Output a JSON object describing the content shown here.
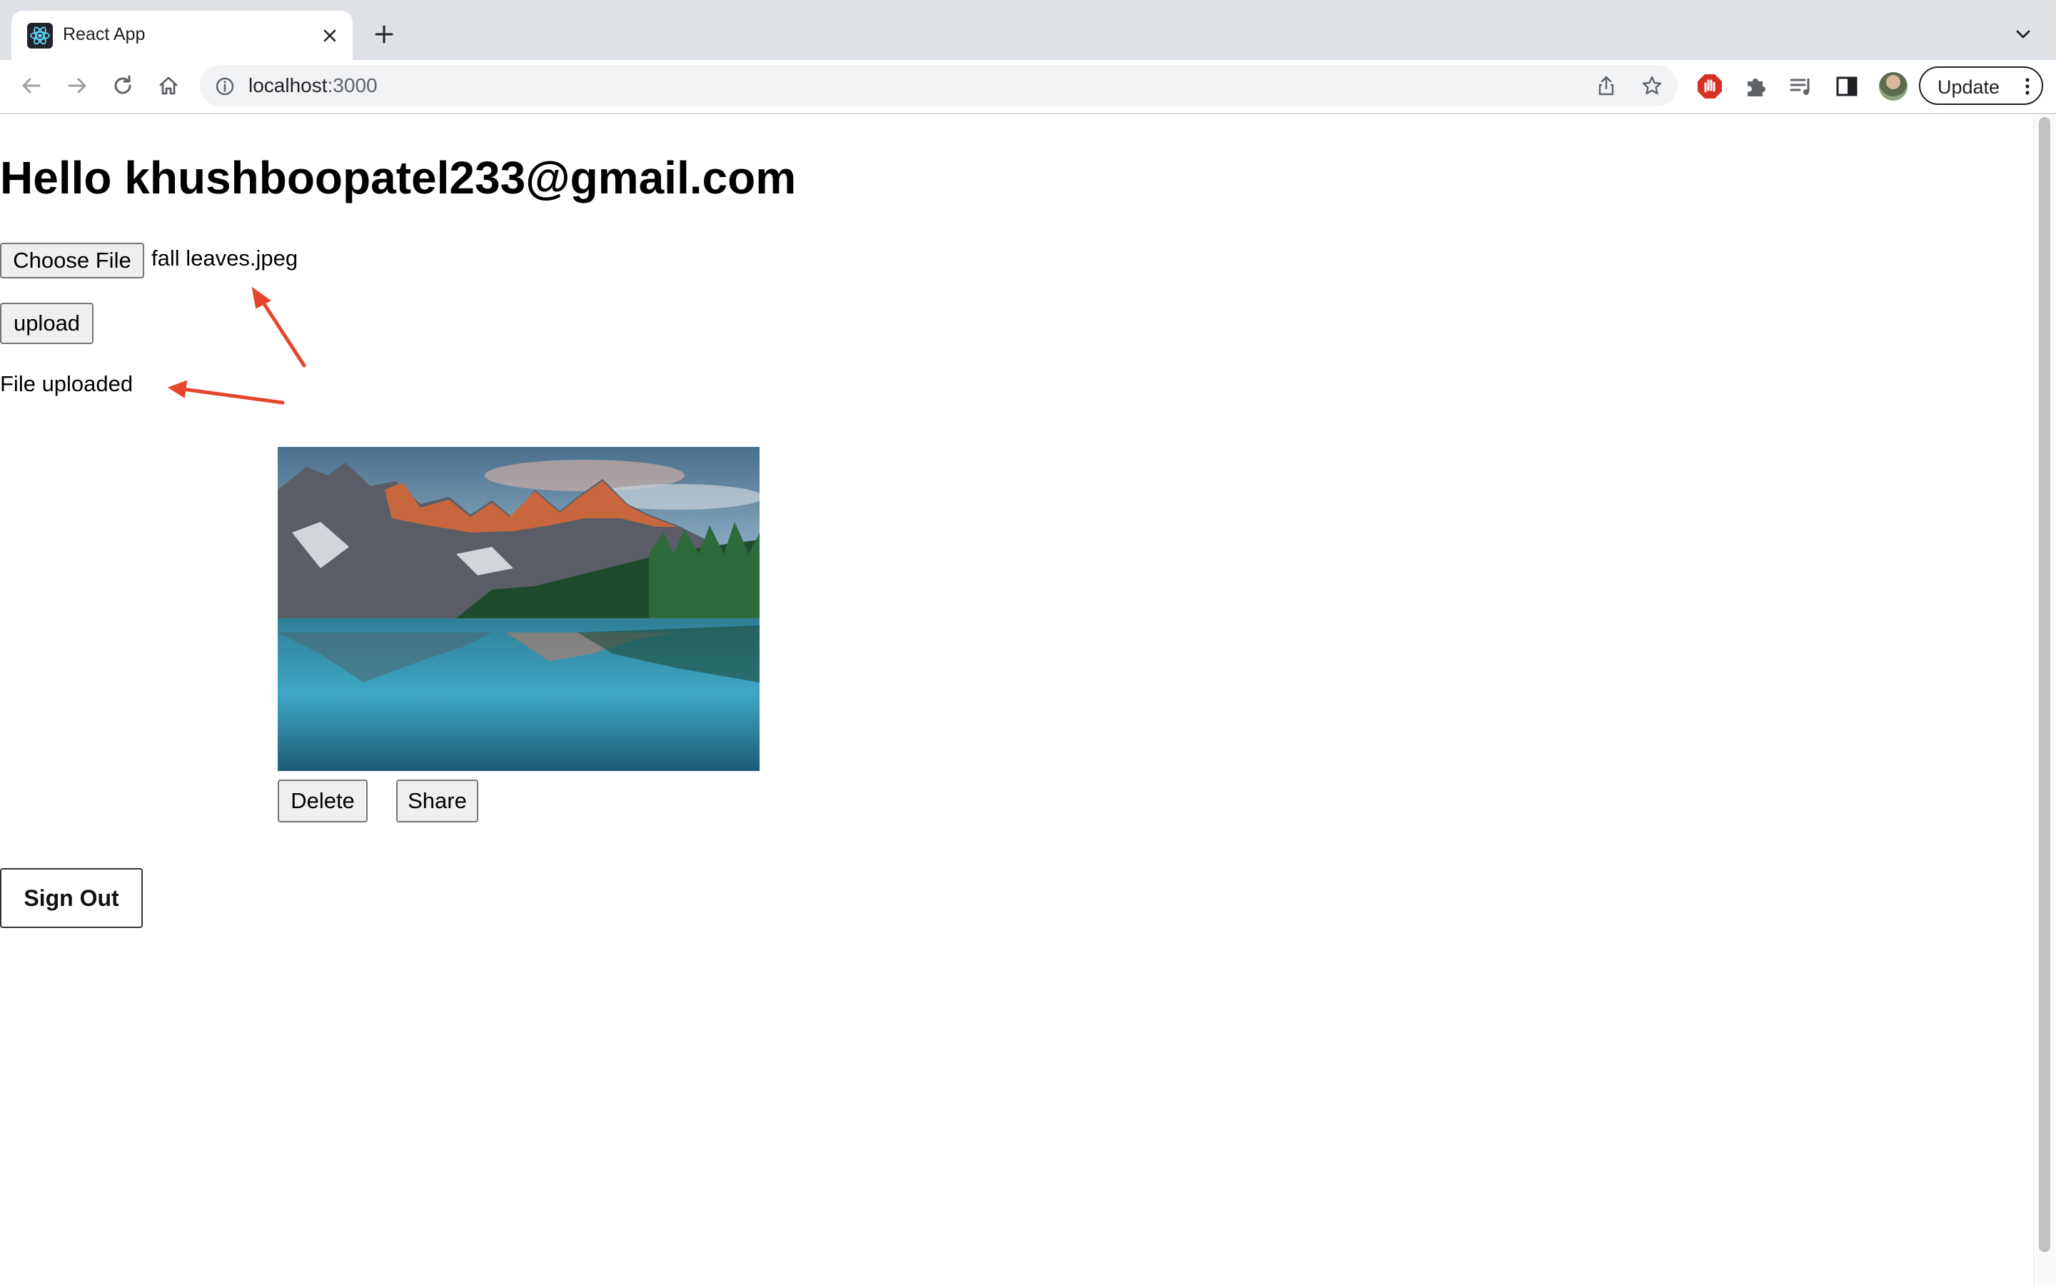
{
  "browser": {
    "tab_title": "React App",
    "address_host": "localhost",
    "address_port": ":3000",
    "update_label": "Update",
    "icons": [
      "react-logo-icon",
      "close-icon",
      "plus-icon",
      "chevron-down-icon",
      "back-arrow-icon",
      "forward-arrow-icon",
      "reload-icon",
      "home-icon",
      "info-icon",
      "share-icon",
      "star-icon",
      "extension-shield-icon",
      "puzzle-icon",
      "media-queue-icon",
      "side-panel-icon",
      "profile-avatar",
      "kebab-menu-icon"
    ]
  },
  "page": {
    "greeting": "Hello khushboopatel233@gmail.com",
    "choose_file_label": "Choose File",
    "selected_file": "fall leaves.jpeg",
    "upload_label": "upload",
    "status_text": "File uploaded",
    "image_subject": "mountain lake landscape",
    "delete_label": "Delete",
    "share_label": "Share",
    "signout_label": "Sign Out"
  },
  "annotation_color": "#e5452b"
}
